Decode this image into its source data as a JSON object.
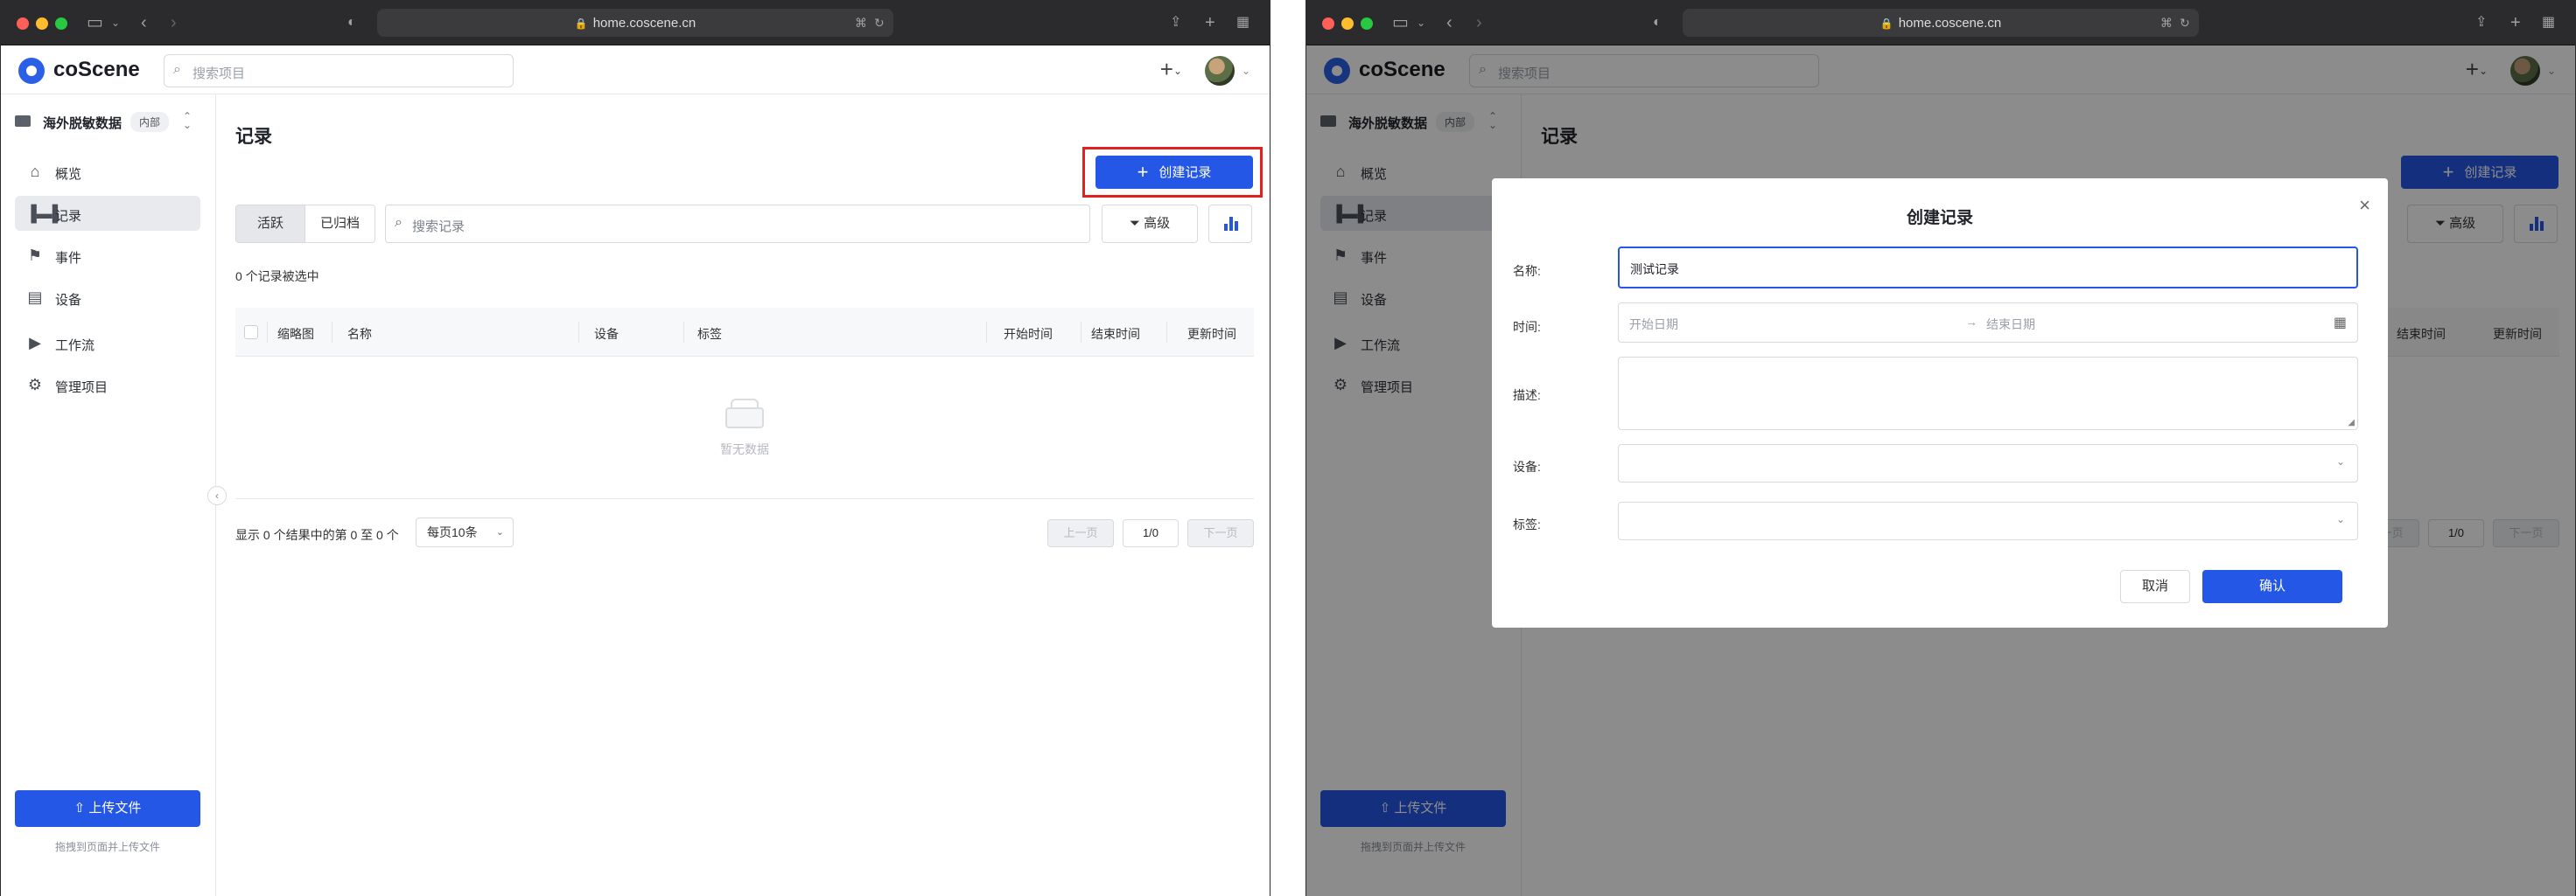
{
  "browser": {
    "url": "home.coscene.cn"
  },
  "header": {
    "brand": "coScene",
    "search_placeholder": "搜索项目",
    "plus": "+"
  },
  "sidebar": {
    "project_name": "海外脱敏数据",
    "project_badge": "内部",
    "items": [
      {
        "label": "概览",
        "icon": "home-icon"
      },
      {
        "label": "记录",
        "icon": "record-icon"
      },
      {
        "label": "事件",
        "icon": "flag-icon"
      },
      {
        "label": "设备",
        "icon": "device-icon"
      },
      {
        "label": "工作流",
        "icon": "play-icon"
      },
      {
        "label": "管理项目",
        "icon": "gear-icon"
      }
    ],
    "upload_label": "上传文件",
    "upload_hint": "拖拽到页面并上传文件"
  },
  "main": {
    "title": "记录",
    "create_label": "创建记录",
    "tabs": [
      "活跃",
      "已归档"
    ],
    "search_placeholder": "搜索记录",
    "advanced_label": "高级",
    "selected_count": "0 个记录被选中",
    "columns": [
      "缩略图",
      "名称",
      "设备",
      "标签",
      "开始时间",
      "结束时间",
      "更新时间"
    ],
    "empty_text": "暂无数据",
    "pagination": {
      "info": "显示 0 个结果中的第 0 至 0 个",
      "page_size": "每页10条",
      "prev": "上一页",
      "page": "1/0",
      "next": "下一页"
    }
  },
  "modal": {
    "title": "创建记录",
    "fields": {
      "name_label": "名称:",
      "name_value": "测试记录",
      "time_label": "时间:",
      "start_placeholder": "开始日期",
      "end_placeholder": "结束日期",
      "desc_label": "描述:",
      "device_label": "设备:",
      "tag_label": "标签:"
    },
    "cancel_label": "取消",
    "confirm_label": "确认"
  },
  "colors": {
    "primary": "#2457e6",
    "highlight": "#e0211e"
  }
}
